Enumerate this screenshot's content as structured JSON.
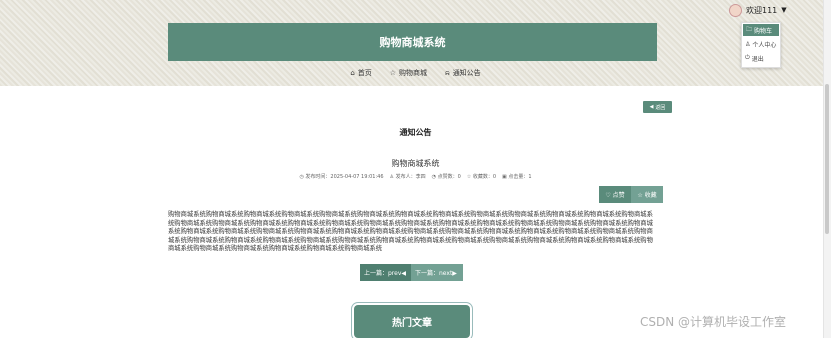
{
  "header": {
    "banner_title": "购物商城系统"
  },
  "user_menu": {
    "greeting": "欢迎111",
    "caret": "▼",
    "items": [
      {
        "icon": "cart-icon",
        "glyph": "🗀",
        "label": "购物车"
      },
      {
        "icon": "user-icon",
        "glyph": "♙",
        "label": "个人中心"
      },
      {
        "icon": "logout-icon",
        "glyph": "⏻",
        "label": "退出"
      }
    ]
  },
  "nav": {
    "items": [
      {
        "icon": "home-icon",
        "glyph": "⌂",
        "label": "首页"
      },
      {
        "icon": "star-icon",
        "glyph": "☆",
        "label": "购物商城"
      },
      {
        "icon": "bell-icon",
        "glyph": "⍾",
        "label": "通知公告"
      }
    ]
  },
  "back": {
    "glyph": "◀",
    "label": "返回"
  },
  "section_title": "通知公告",
  "article": {
    "title": "购物商城系统",
    "meta": [
      {
        "icon": "clock-icon",
        "glyph": "◷",
        "text": "发布时间：2025-04-07 19:01:46"
      },
      {
        "icon": "person-icon",
        "glyph": "♙",
        "text": "发布人：李四"
      },
      {
        "icon": "thumb-icon",
        "glyph": "◔",
        "text": "点赞数：0"
      },
      {
        "icon": "fav-icon",
        "glyph": "☆",
        "text": "收藏数：0"
      },
      {
        "icon": "view-icon",
        "glyph": "▣",
        "text": "点击量：1"
      }
    ],
    "like_label": "♡ 点赞",
    "fav_label": "☆ 收藏",
    "content": "购物商城系统购物商城系统购物商城系统购物商城系统购物商城系统购物商城系统购物商城系统购物商城系统购物商城系统购物商城系统购物商城系统购物商城系统购物商城系统购物商城系统购物商城系统购物商城系统购物商城系统购物商城系统购物商城系统购物商城系统购物商城系统购物商城系统购物商城系统购物商城系统购物商城系统购物商城系统购物商城系统购物商城系统购物商城系统购物商城系统购物商城系统购物商城系统购物商城系统购物商城系统购物商城系统购物商城系统购物商城系统购物商城系统购物商城系统购物商城系统购物商城系统购物商城系统购物商城系统购物商城系统购物商城系统购物商城系统购物商城系统购物商城系统购物商城系统购物商城系统购物商城系统购物商城系统购物商城系统购物商城系统购物商城系统购物商城系统购物商城系统"
  },
  "pager": {
    "prev": "上一篇：prev◀",
    "next": "下一篇：next▶"
  },
  "hot_title": "热门文章",
  "watermark": "CSDN @计算机毕设工作室",
  "colors": {
    "primary": "#5a8b7b",
    "secondary": "#73a194"
  }
}
